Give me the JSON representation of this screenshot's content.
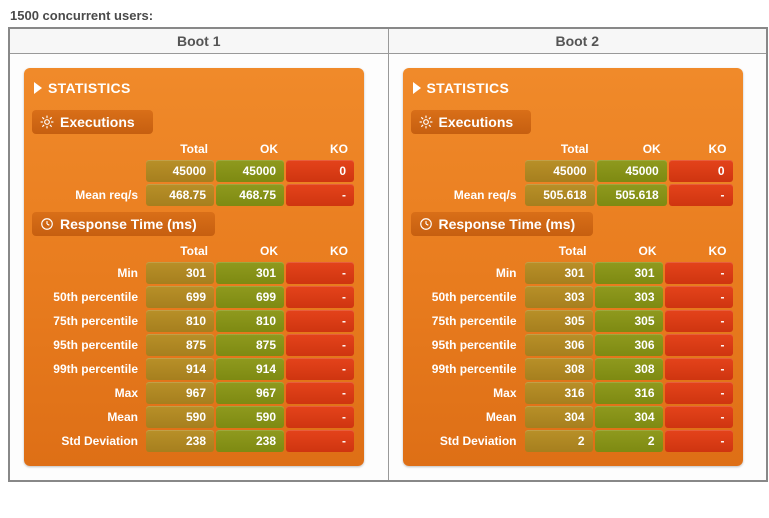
{
  "title": "1500 concurrent users:",
  "columns": [
    "Boot 1",
    "Boot 2"
  ],
  "labels": {
    "statistics": "STATISTICS",
    "executions": "Executions",
    "responseTime": "Response Time (ms)",
    "headers": {
      "total": "Total",
      "ok": "OK",
      "ko": "KO"
    },
    "execRows": [
      "",
      "Mean req/s"
    ],
    "rtRows": [
      "Min",
      "50th percentile",
      "75th percentile",
      "95th percentile",
      "99th percentile",
      "Max",
      "Mean",
      "Std Deviation"
    ]
  },
  "panels": [
    {
      "exec": {
        "counts": {
          "total": "45000",
          "ok": "45000",
          "ko": "0"
        },
        "meanReq": {
          "total": "468.75",
          "ok": "468.75",
          "ko": "-"
        }
      },
      "rt": [
        {
          "total": "301",
          "ok": "301",
          "ko": "-"
        },
        {
          "total": "699",
          "ok": "699",
          "ko": "-"
        },
        {
          "total": "810",
          "ok": "810",
          "ko": "-"
        },
        {
          "total": "875",
          "ok": "875",
          "ko": "-"
        },
        {
          "total": "914",
          "ok": "914",
          "ko": "-"
        },
        {
          "total": "967",
          "ok": "967",
          "ko": "-"
        },
        {
          "total": "590",
          "ok": "590",
          "ko": "-"
        },
        {
          "total": "238",
          "ok": "238",
          "ko": "-"
        }
      ]
    },
    {
      "exec": {
        "counts": {
          "total": "45000",
          "ok": "45000",
          "ko": "0"
        },
        "meanReq": {
          "total": "505.618",
          "ok": "505.618",
          "ko": "-"
        }
      },
      "rt": [
        {
          "total": "301",
          "ok": "301",
          "ko": "-"
        },
        {
          "total": "303",
          "ok": "303",
          "ko": "-"
        },
        {
          "total": "305",
          "ok": "305",
          "ko": "-"
        },
        {
          "total": "306",
          "ok": "306",
          "ko": "-"
        },
        {
          "total": "308",
          "ok": "308",
          "ko": "-"
        },
        {
          "total": "316",
          "ok": "316",
          "ko": "-"
        },
        {
          "total": "304",
          "ok": "304",
          "ko": "-"
        },
        {
          "total": "2",
          "ok": "2",
          "ko": "-"
        }
      ]
    }
  ]
}
